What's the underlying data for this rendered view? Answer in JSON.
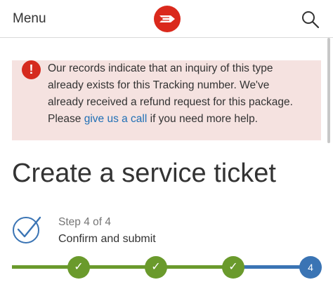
{
  "header": {
    "menu_label": "Menu",
    "logo_icon": "canada-post-logo-icon",
    "search_icon": "search-icon",
    "brand_color": "#da291c"
  },
  "alert": {
    "icon": "exclamation-circle-icon",
    "line1": "Our records indicate that an inquiry of this type",
    "line2": "already exists for this Tracking number. We've",
    "line3": "already received a refund request for this package.",
    "line4_before": "Please ",
    "link_text": "give us a call",
    "line4_after": " if you need more help.",
    "background": "#f5e2e0",
    "icon_color": "#d52a1e",
    "link_color": "#1f6fb5"
  },
  "page_title": "Create a service ticket",
  "step": {
    "icon": "check-circle-icon",
    "count_label": "Step 4 of 4",
    "name": "Confirm and submit"
  },
  "progress": {
    "steps": [
      {
        "state": "complete",
        "icon": "check-icon"
      },
      {
        "state": "complete",
        "icon": "check-icon"
      },
      {
        "state": "complete",
        "icon": "check-icon"
      },
      {
        "state": "current",
        "label": "4"
      }
    ],
    "complete_color": "#6a9a2c",
    "current_color": "#3a74b4"
  }
}
